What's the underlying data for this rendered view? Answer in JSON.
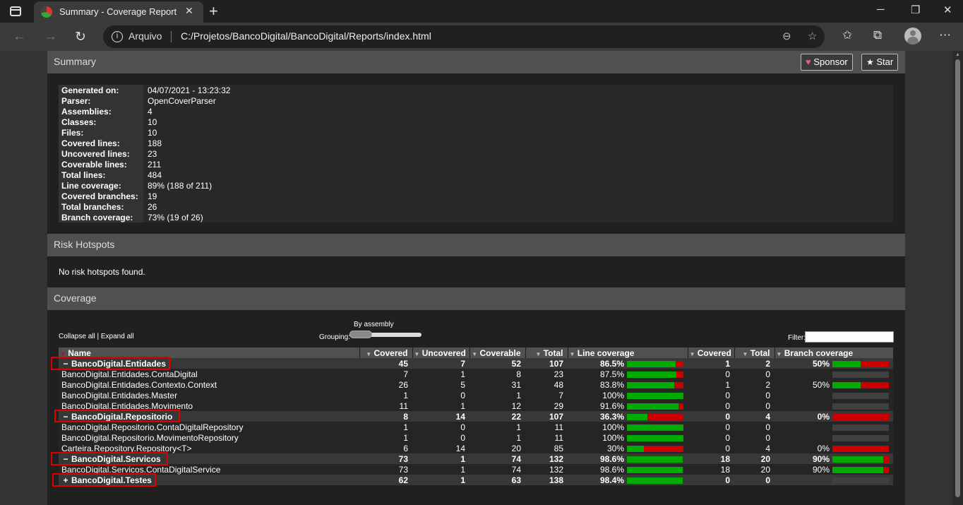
{
  "browser": {
    "tab_title": "Summary - Coverage Report",
    "scheme_label": "Arquivo",
    "url": "C:/Projetos/BancoDigital/BancoDigital/Reports/index.html"
  },
  "summary": {
    "title": "Summary",
    "sponsor_label": "Sponsor",
    "star_label": "Star",
    "rows": [
      {
        "label": "Generated on:",
        "value": "04/07/2021 - 13:23:32"
      },
      {
        "label": "Parser:",
        "value": "OpenCoverParser"
      },
      {
        "label": "Assemblies:",
        "value": "4"
      },
      {
        "label": "Classes:",
        "value": "10"
      },
      {
        "label": "Files:",
        "value": "10"
      },
      {
        "label": "Covered lines:",
        "value": "188"
      },
      {
        "label": "Uncovered lines:",
        "value": "23"
      },
      {
        "label": "Coverable lines:",
        "value": "211"
      },
      {
        "label": "Total lines:",
        "value": "484"
      },
      {
        "label": "Line coverage:",
        "value": "89% (188 of 211)"
      },
      {
        "label": "Covered branches:",
        "value": "19"
      },
      {
        "label": "Total branches:",
        "value": "26"
      },
      {
        "label": "Branch coverage:",
        "value": "73% (19 of 26)"
      }
    ]
  },
  "risk": {
    "title": "Risk Hotspots",
    "message": "No risk hotspots found."
  },
  "coverage": {
    "title": "Coverage",
    "collapse_all": "Collapse all",
    "separator": "|",
    "expand_all": "Expand all",
    "grouping_label": "Grouping:",
    "grouping_value": "By assembly",
    "filter_label": "Filter:",
    "columns": [
      "Name",
      "Covered",
      "Uncovered",
      "Coverable",
      "Total",
      "Line coverage",
      "Covered",
      "Total",
      "Branch coverage"
    ],
    "rows": [
      {
        "type": "assembly",
        "toggle": "−",
        "name": "BancoDigital.Entidades",
        "covered": "45",
        "uncovered": "7",
        "coverable": "52",
        "total": "107",
        "line_pct": "86.5%",
        "line_fraction": 0.865,
        "b_covered": "1",
        "b_total": "2",
        "branch_pct": "50%",
        "branch_fraction": 0.5
      },
      {
        "type": "class",
        "name": "BancoDigital.Entidades.ContaDigital",
        "covered": "7",
        "uncovered": "1",
        "coverable": "8",
        "total": "23",
        "line_pct": "87.5%",
        "line_fraction": 0.875,
        "b_covered": "0",
        "b_total": "0",
        "branch_pct": "",
        "branch_fraction": null
      },
      {
        "type": "class",
        "name": "BancoDigital.Entidades.Contexto.Context",
        "covered": "26",
        "uncovered": "5",
        "coverable": "31",
        "total": "48",
        "line_pct": "83.8%",
        "line_fraction": 0.838,
        "b_covered": "1",
        "b_total": "2",
        "branch_pct": "50%",
        "branch_fraction": 0.5
      },
      {
        "type": "class",
        "name": "BancoDigital.Entidades.Master",
        "covered": "1",
        "uncovered": "0",
        "coverable": "1",
        "total": "7",
        "line_pct": "100%",
        "line_fraction": 1.0,
        "b_covered": "0",
        "b_total": "0",
        "branch_pct": "",
        "branch_fraction": null
      },
      {
        "type": "class",
        "name": "BancoDigital.Entidades.Movimento",
        "covered": "11",
        "uncovered": "1",
        "coverable": "12",
        "total": "29",
        "line_pct": "91.6%",
        "line_fraction": 0.916,
        "b_covered": "0",
        "b_total": "0",
        "branch_pct": "",
        "branch_fraction": null
      },
      {
        "type": "assembly",
        "toggle": "−",
        "name": "BancoDigital.Repositorio",
        "covered": "8",
        "uncovered": "14",
        "coverable": "22",
        "total": "107",
        "line_pct": "36.3%",
        "line_fraction": 0.363,
        "b_covered": "0",
        "b_total": "4",
        "branch_pct": "0%",
        "branch_fraction": 0.0
      },
      {
        "type": "class",
        "name": "BancoDigital.Repositorio.ContaDigitalRepository",
        "covered": "1",
        "uncovered": "0",
        "coverable": "1",
        "total": "11",
        "line_pct": "100%",
        "line_fraction": 1.0,
        "b_covered": "0",
        "b_total": "0",
        "branch_pct": "",
        "branch_fraction": null
      },
      {
        "type": "class",
        "name": "BancoDigital.Repositorio.MovimentoRepository",
        "covered": "1",
        "uncovered": "0",
        "coverable": "1",
        "total": "11",
        "line_pct": "100%",
        "line_fraction": 1.0,
        "b_covered": "0",
        "b_total": "0",
        "branch_pct": "",
        "branch_fraction": null
      },
      {
        "type": "class",
        "name": "Carteira.Repository.Repository<T>",
        "covered": "6",
        "uncovered": "14",
        "coverable": "20",
        "total": "85",
        "line_pct": "30%",
        "line_fraction": 0.3,
        "b_covered": "0",
        "b_total": "4",
        "branch_pct": "0%",
        "branch_fraction": 0.0
      },
      {
        "type": "assembly",
        "toggle": "−",
        "name": "BancoDigital.Servicos",
        "covered": "73",
        "uncovered": "1",
        "coverable": "74",
        "total": "132",
        "line_pct": "98.6%",
        "line_fraction": 0.986,
        "b_covered": "18",
        "b_total": "20",
        "branch_pct": "90%",
        "branch_fraction": 0.9
      },
      {
        "type": "class",
        "name": "BancoDigital.Servicos.ContaDigitalService",
        "covered": "73",
        "uncovered": "1",
        "coverable": "74",
        "total": "132",
        "line_pct": "98.6%",
        "line_fraction": 0.986,
        "b_covered": "18",
        "b_total": "20",
        "branch_pct": "90%",
        "branch_fraction": 0.9
      },
      {
        "type": "assembly",
        "toggle": "+",
        "name": "BancoDigital.Testes",
        "covered": "62",
        "uncovered": "1",
        "coverable": "63",
        "total": "138",
        "line_pct": "98.4%",
        "line_fraction": 0.984,
        "b_covered": "0",
        "b_total": "0",
        "branch_pct": "",
        "branch_fraction": null
      }
    ]
  },
  "colors": {
    "covered": "#00aa00",
    "uncovered": "#cc0000",
    "highlight": "#e00000"
  }
}
